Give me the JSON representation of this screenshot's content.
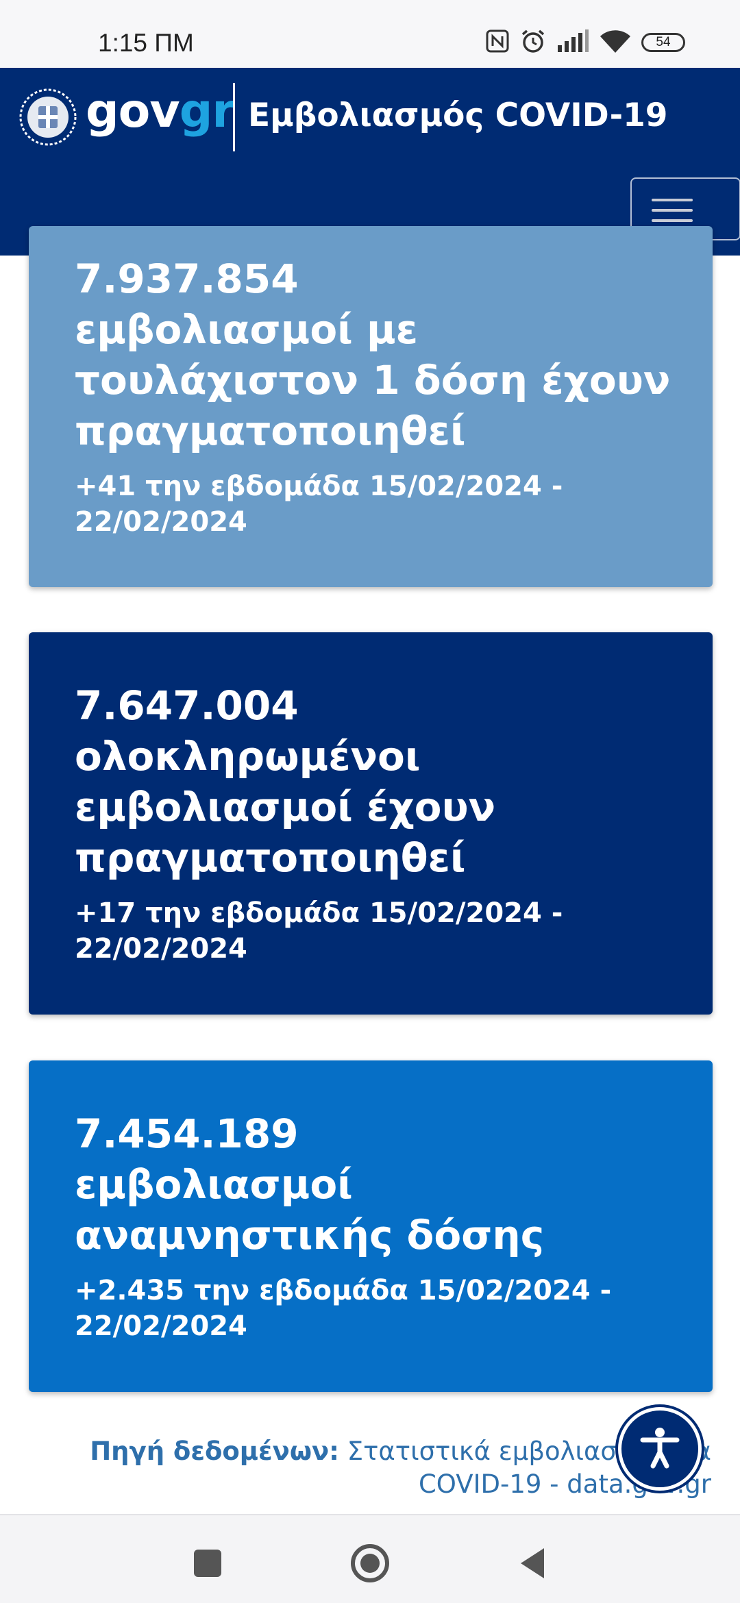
{
  "status_bar": {
    "time": "1:15 ΠΜ",
    "battery": "54",
    "icons": [
      "nfc-icon",
      "alarm-icon",
      "signal-icon",
      "wifi-icon",
      "battery-icon"
    ]
  },
  "header": {
    "logo_gov": "gov",
    "logo_gr": "gr",
    "title": "Εμβολιασμός COVID-19",
    "colors": {
      "background": "#002b73",
      "logo_accent": "#1ea3e0"
    }
  },
  "cards": [
    {
      "number": "7.937.854",
      "text": "εμβολιασμοί με τουλάχιστον 1 δόση έχουν πραγματοποιηθεί",
      "weekly": "+41 την εβδομάδα 15/02/2024 - 22/02/2024",
      "color": "#6a9cc8"
    },
    {
      "number": "7.647.004",
      "text": "ολοκληρωμένοι εμβολιασμοί έχουν πραγματοποιηθεί",
      "weekly": "+17 την εβδομάδα 15/02/2024 - 22/02/2024",
      "color": "#002b73"
    },
    {
      "number": "7.454.189",
      "text": "εμβολιασμοί αναμνηστικής δόσης",
      "weekly": "+2.435 την εβδομάδα 15/02/2024 - 22/02/2024",
      "color": "#066fc6"
    }
  ],
  "source": {
    "label": "Πηγή δεδομένων:",
    "link": "Στατιστικά εμβολιασμού για COVID-19 - data.gov.gr"
  },
  "accessibility": {
    "icon": "accessibility-icon"
  },
  "nav_bar": {
    "icons": [
      "recents-square-icon",
      "home-circle-icon",
      "back-triangle-icon"
    ]
  }
}
